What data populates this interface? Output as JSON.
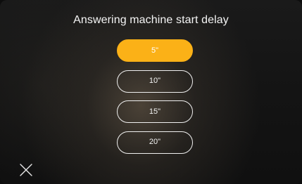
{
  "title": "Answering machine start delay",
  "options": [
    {
      "label": "5\"",
      "selected": true
    },
    {
      "label": "10\"",
      "selected": false
    },
    {
      "label": "15\"",
      "selected": false
    },
    {
      "label": "20\"",
      "selected": false
    }
  ],
  "close_icon": "close-icon",
  "colors": {
    "accent": "#fbb117",
    "background": "#141414",
    "text": "#f4f4f4"
  }
}
